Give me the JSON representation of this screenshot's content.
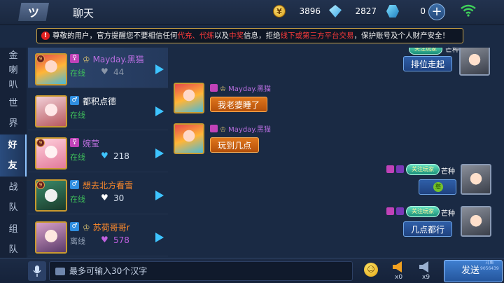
{
  "header": {
    "back_label": "ツ",
    "title": "聊天",
    "gold": "3896",
    "diamonds": "2827",
    "vouchers": "0",
    "plus_label": "+"
  },
  "notice": {
    "icon": "!",
    "parts": [
      "尊敬的用户，官方提醒您不要相信任何",
      "代充、代练",
      "以及",
      "中奖",
      "信息，拒绝",
      "线下或第三方平台交易",
      "，保护账号及个人财产安全！"
    ]
  },
  "tabs": [
    {
      "label": "金喇叭",
      "chars": [
        "金",
        "喇",
        "叭"
      ]
    },
    {
      "label": "世界",
      "chars": [
        "世",
        "界"
      ]
    },
    {
      "label": "好友",
      "chars": [
        "好",
        "友"
      ]
    },
    {
      "label": "战队",
      "chars": [
        "战",
        "队"
      ]
    },
    {
      "label": "组队",
      "chars": [
        "组",
        "队"
      ]
    }
  ],
  "friends": [
    {
      "name": "Mayday.黑猫",
      "gender": "♀",
      "status": "在线",
      "intimacy": "44",
      "level": "9"
    },
    {
      "name": "都积点德",
      "gender": "♂",
      "status": "在线",
      "intimacy": "",
      "level": ""
    },
    {
      "name": "婉莹",
      "gender": "♀",
      "status": "在线",
      "intimacy": "218",
      "level": "9"
    },
    {
      "name": "想去北方看雪",
      "gender": "♂",
      "status": "在线",
      "intimacy": "30",
      "level": "9"
    },
    {
      "name": "苏荷哥哥r",
      "gender": "♂",
      "status": "离线",
      "intimacy": "578",
      "level": ""
    }
  ],
  "chat": {
    "partner_name": "Mayday.黑猫",
    "self_name": "芒种",
    "self_badge": "关注玩家",
    "messages": [
      {
        "from": "self",
        "text": "排位走起"
      },
      {
        "from": "partner",
        "text": "我老婆睡了"
      },
      {
        "from": "partner",
        "text": "玩到几点"
      },
      {
        "from": "self",
        "text": "",
        "emoji": "憨"
      },
      {
        "from": "self",
        "text": "几点都行"
      }
    ]
  },
  "input": {
    "placeholder": "最多可输入30个汉字"
  },
  "toolbar": {
    "emoji": "☺",
    "horn_gold_count": "x0",
    "horn_blue_count": "x9",
    "send_label": "发送"
  },
  "watermark": [
    "斗鱼",
    "9056439"
  ],
  "colors": {
    "accent_blue": "#3ec4ff",
    "online_green": "#3fc25a",
    "notice_red": "#ff3b3b",
    "bubble_orange": "#e0771c",
    "bubble_blue": "#2f5fa8"
  }
}
